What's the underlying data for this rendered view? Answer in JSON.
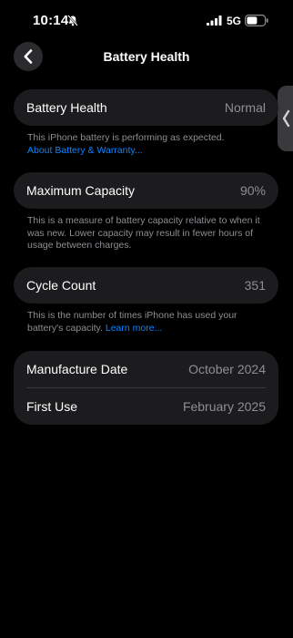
{
  "status_bar": {
    "time": "10:14",
    "network": "5G",
    "icons": [
      "bell-off-icon",
      "signal-icon",
      "battery-icon"
    ]
  },
  "nav": {
    "title": "Battery Health",
    "back_icon": "chevron-left-icon"
  },
  "side_handle": {
    "icon": "chevron-left-icon"
  },
  "battery_health": {
    "label": "Battery Health",
    "value": "Normal",
    "footnote": "This iPhone battery is performing as expected.",
    "link": "About Battery & Warranty..."
  },
  "maximum_capacity": {
    "label": "Maximum Capacity",
    "value": "90%",
    "footnote": "This is a measure of battery capacity relative to when it was new. Lower capacity may result in fewer hours of usage between charges."
  },
  "cycle_count": {
    "label": "Cycle Count",
    "value": "351",
    "footnote": "This is the number of times iPhone has used your battery's capacity.",
    "link": "Learn more..."
  },
  "dates": {
    "manufacture_label": "Manufacture Date",
    "manufacture_value": "October 2024",
    "first_use_label": "First Use",
    "first_use_value": "February 2025"
  },
  "colors": {
    "background": "#000000",
    "card": "#1c1c1e",
    "secondary_text": "#8e8e93",
    "link": "#0a84ff"
  }
}
